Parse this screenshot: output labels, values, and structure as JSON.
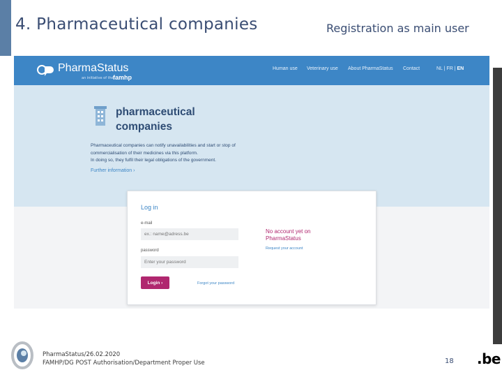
{
  "slide": {
    "title": "4. Pharmaceutical companies",
    "subtitle": "Registration as main user"
  },
  "site": {
    "logo_text": "PharmaStatus",
    "logo_sub": "an initiative of the",
    "logo_brand": "famhp",
    "nav": [
      "Human use",
      "Veterinary use",
      "About PharmaStatus",
      "Contact"
    ],
    "languages": [
      "NL",
      "FR",
      "EN"
    ],
    "language_active": "EN",
    "accent_color": "#3d86c6",
    "cta_color": "#b0276f"
  },
  "hero": {
    "title_line1": "pharmaceutical",
    "title_line2": "companies",
    "desc_line1": "Pharmaceutical companies can notify unavailabilities and start or stop of",
    "desc_line2": "commercialisation of their medicines via this platform.",
    "desc_line3": "In doing so, they fulfil their legal obligations of the government.",
    "further_link": "Further information ›"
  },
  "login": {
    "title": "Log in",
    "email_label": "e-mail",
    "email_placeholder": "ex.: name@adress.be",
    "password_label": "password",
    "password_placeholder": "Enter your password",
    "button_label": "Login ›",
    "forgot_link": "Forgot your password",
    "no_account_line1": "No account yet on",
    "no_account_line2": "PharmaStatus",
    "request_link": "Request your account"
  },
  "footer": {
    "line1": "PharmaStatus/26.02.2020",
    "line2": "FAMHP/DG POST Authorisation/Department Proper Use",
    "page_number": "18",
    "be_logo": ".be"
  }
}
